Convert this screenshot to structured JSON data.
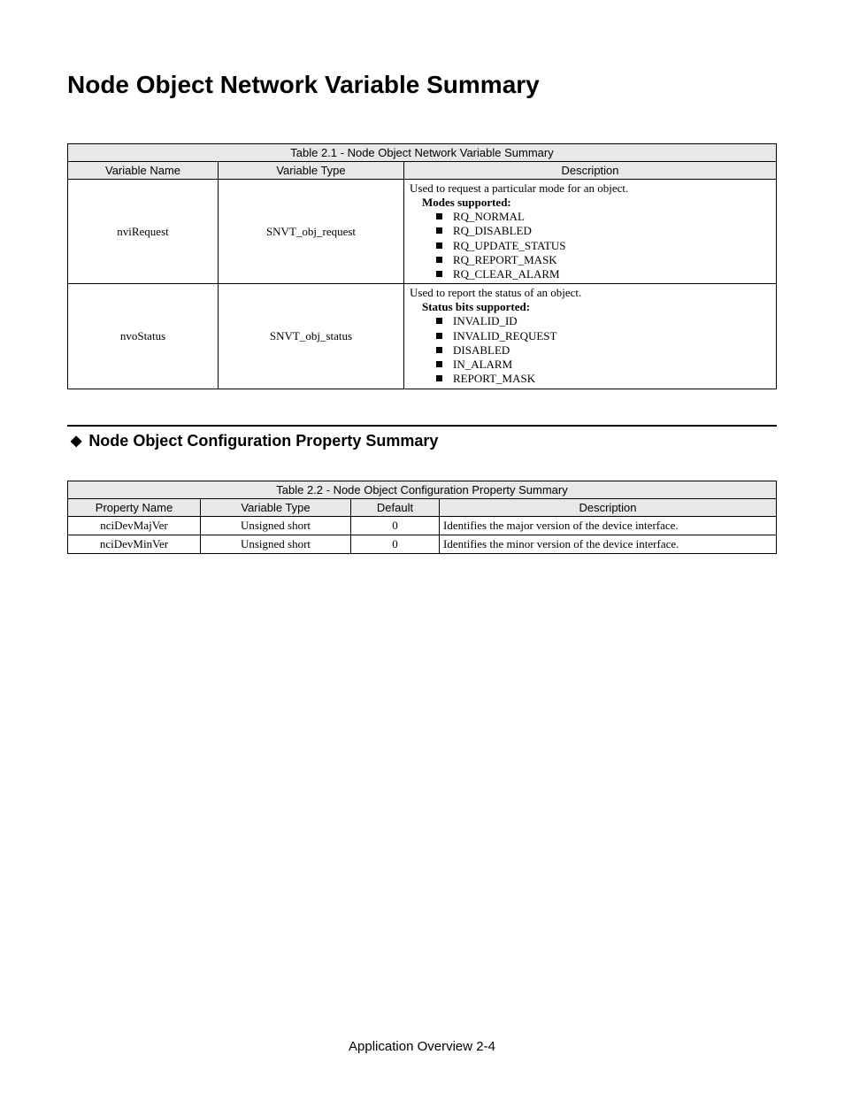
{
  "pageTitle": "Node Object Network Variable Summary",
  "table1": {
    "caption": "Table 2.1 - Node Object Network Variable Summary",
    "headers": {
      "c0": "Variable Name",
      "c1": "Variable Type",
      "c2": "Description"
    },
    "rows": [
      {
        "name": "nviRequest",
        "type": "SNVT_obj_request",
        "intro": "Used to request a particular mode for an object.",
        "subhead": "Modes supported:",
        "items": [
          "RQ_NORMAL",
          "RQ_DISABLED",
          "RQ_UPDATE_STATUS",
          "RQ_REPORT_MASK",
          "RQ_CLEAR_ALARM"
        ]
      },
      {
        "name": "nvoStatus",
        "type": "SNVT_obj_status",
        "intro": "Used to report the status of an object.",
        "subhead": "Status bits supported:",
        "items": [
          "INVALID_ID",
          "INVALID_REQUEST",
          "DISABLED",
          "IN_ALARM",
          "REPORT_MASK"
        ]
      }
    ]
  },
  "section2Title": "Node Object Configuration Property Summary",
  "table2": {
    "caption": "Table 2.2 - Node Object Configuration Property Summary",
    "headers": {
      "c0": "Property Name",
      "c1": "Variable Type",
      "c2": "Default",
      "c3": "Description"
    },
    "rows": [
      {
        "name": "nciDevMajVer",
        "type": "Unsigned short",
        "default": "0",
        "desc": "Identifies the major version of the device interface."
      },
      {
        "name": "nciDevMinVer",
        "type": "Unsigned short",
        "default": "0",
        "desc": "Identifies the minor version of the device interface."
      }
    ]
  },
  "footer": "Application Overview 2-4"
}
